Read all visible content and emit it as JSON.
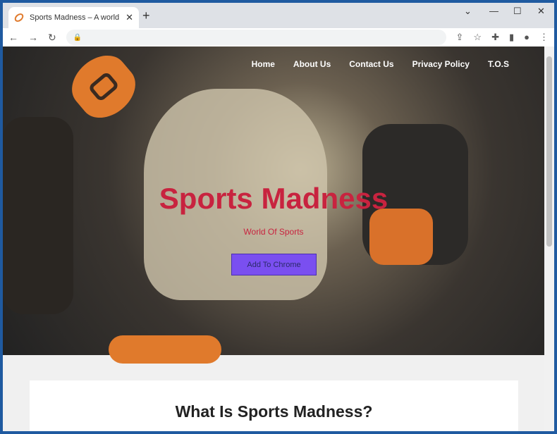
{
  "browser": {
    "tab_title": "Sports Madness – A world of sports",
    "new_tab": "+",
    "close": "✕",
    "minimize": "⌄",
    "min": "—",
    "max": "☐",
    "x": "✕"
  },
  "nav": [
    "Home",
    "About Us",
    "Contact Us",
    "Privacy Policy",
    "T.O.S"
  ],
  "hero": {
    "title": "Sports Madness",
    "subtitle": "World Of Sports",
    "cta": "Add To Chrome"
  },
  "section": {
    "heading": "What Is Sports Madness?"
  },
  "colors": {
    "accent": "#c8233f",
    "button": "#7a4ff0",
    "brand": "#e07a2c"
  }
}
